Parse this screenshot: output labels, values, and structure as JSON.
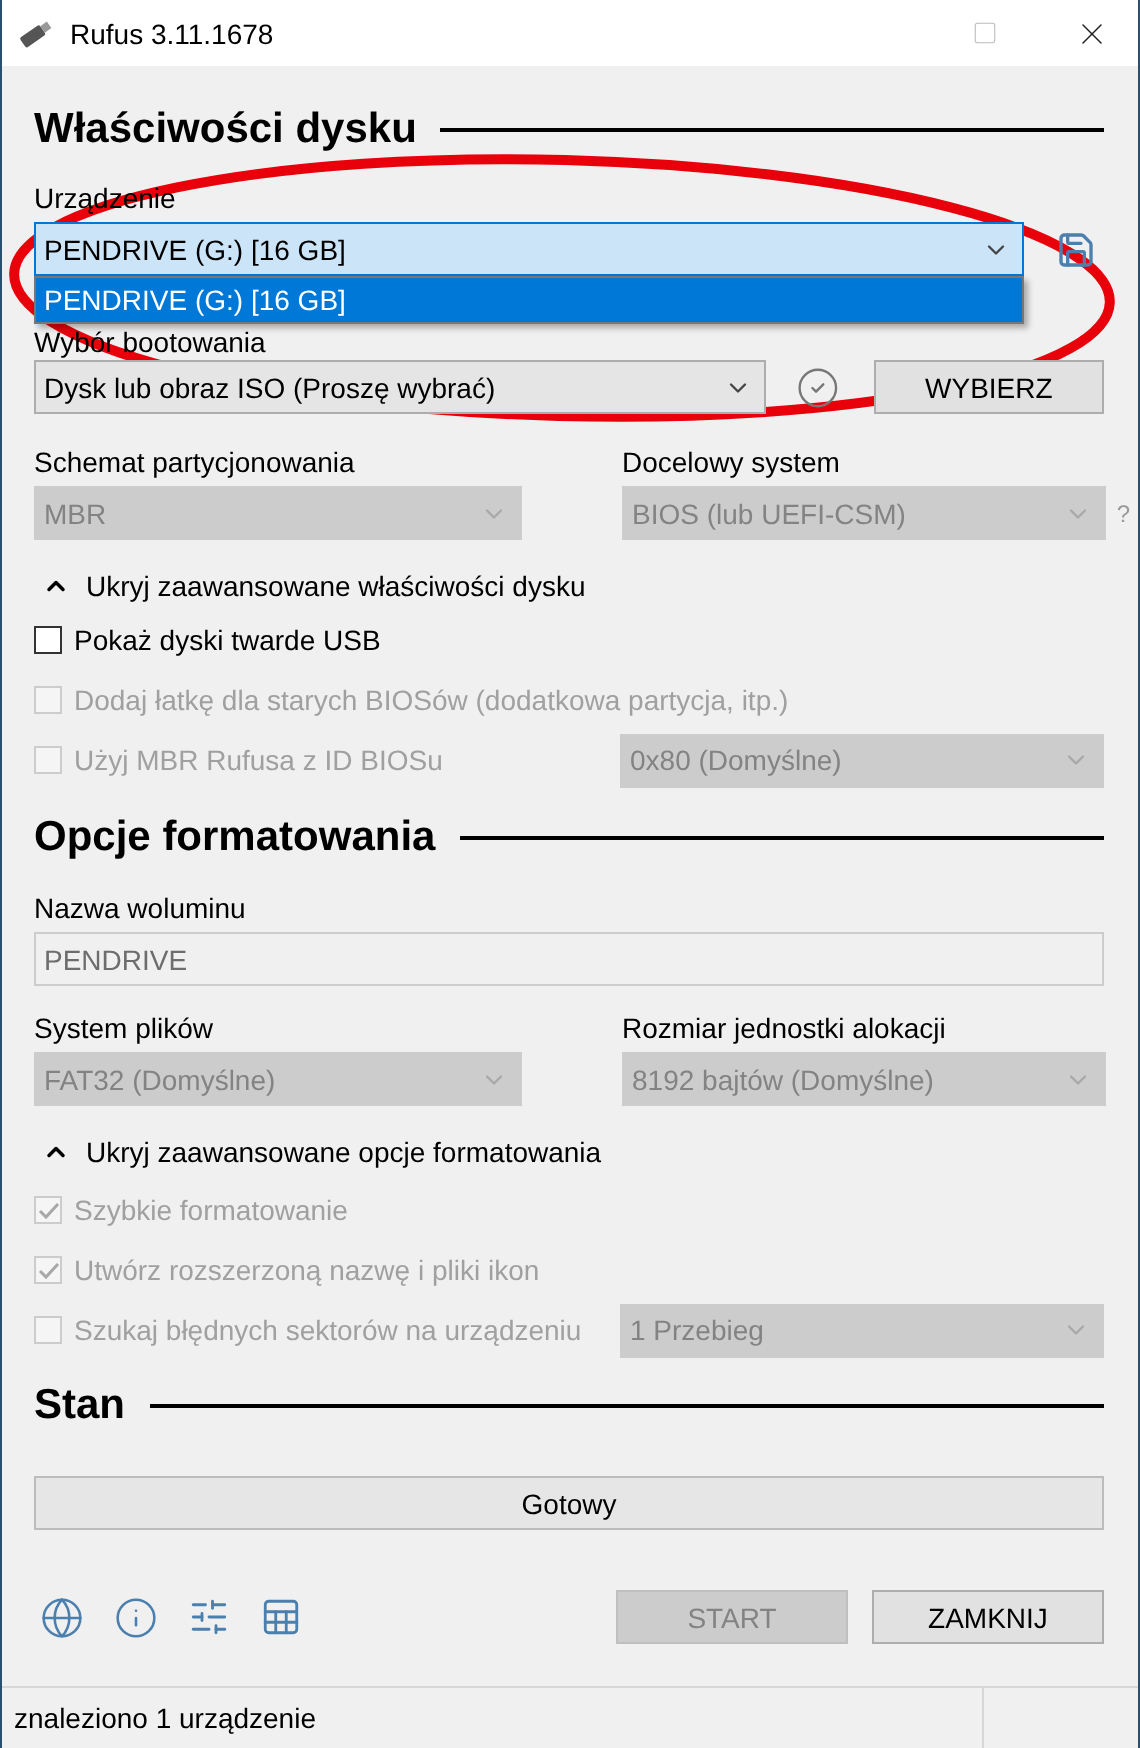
{
  "window": {
    "title": "Rufus 3.11.1678"
  },
  "drive_properties": {
    "heading": "Właściwości dysku",
    "device": {
      "label": "Urządzenie",
      "value": "PENDRIVE (G:) [16 GB]",
      "expanded": true,
      "options": [
        {
          "text": "PENDRIVE (G:) [16 GB]",
          "selected": true
        }
      ]
    },
    "boot_selection": {
      "label": "Wybór bootowania",
      "value": "Dysk lub obraz ISO (Proszę wybrać)",
      "disabled": false,
      "button": "WYBIERZ"
    },
    "partition_scheme": {
      "label": "Schemat partycjonowania",
      "value": "MBR",
      "disabled": true
    },
    "target_system": {
      "label": "Docelowy system",
      "value": "BIOS (lub UEFI-CSM)",
      "disabled": true,
      "help": "?"
    },
    "advanced": {
      "label": "Ukryj zaawansowane właściwości dysku",
      "expanded": true
    },
    "options": [
      {
        "label": "Pokaż dyski twarde USB",
        "checked": false,
        "disabled": false
      },
      {
        "label": "Dodaj łatkę dla starych BIOSów (dodatkowa partycja, itp.)",
        "checked": false,
        "disabled": true
      },
      {
        "label": "Użyj MBR Rufusa z ID BIOSu",
        "checked": false,
        "disabled": true,
        "select": {
          "value": "0x80 (Domyślne)",
          "disabled": true
        }
      }
    ]
  },
  "format_options": {
    "heading": "Opcje formatowania",
    "volume_label": {
      "label": "Nazwa woluminu",
      "value": "PENDRIVE",
      "disabled": true
    },
    "file_system": {
      "label": "System plików",
      "value": "FAT32 (Domyślne)",
      "disabled": true
    },
    "cluster_size": {
      "label": "Rozmiar jednostki alokacji",
      "value": "8192 bajtów (Domyślne)",
      "disabled": true
    },
    "advanced": {
      "label": "Ukryj zaawansowane opcje formatowania",
      "expanded": true
    },
    "options": [
      {
        "label": "Szybkie formatowanie",
        "checked": true,
        "disabled": true
      },
      {
        "label": "Utwórz rozszerzoną nazwę i pliki ikon",
        "checked": true,
        "disabled": true
      },
      {
        "label": "Szukaj błędnych sektorów na urządzeniu",
        "checked": false,
        "disabled": true,
        "select": {
          "value": "1 Przebieg",
          "disabled": true
        }
      }
    ]
  },
  "status": {
    "heading": "Stan",
    "progress": {
      "text": "Gotowy",
      "level": 0
    }
  },
  "buttons": [
    {
      "label": "START",
      "disabled": true
    },
    {
      "label": "ZAMKNIJ",
      "disabled": false
    }
  ],
  "status_bar": {
    "text": "znaleziono 1 urządzenie"
  },
  "annotation": {
    "kind": "ellipse"
  }
}
